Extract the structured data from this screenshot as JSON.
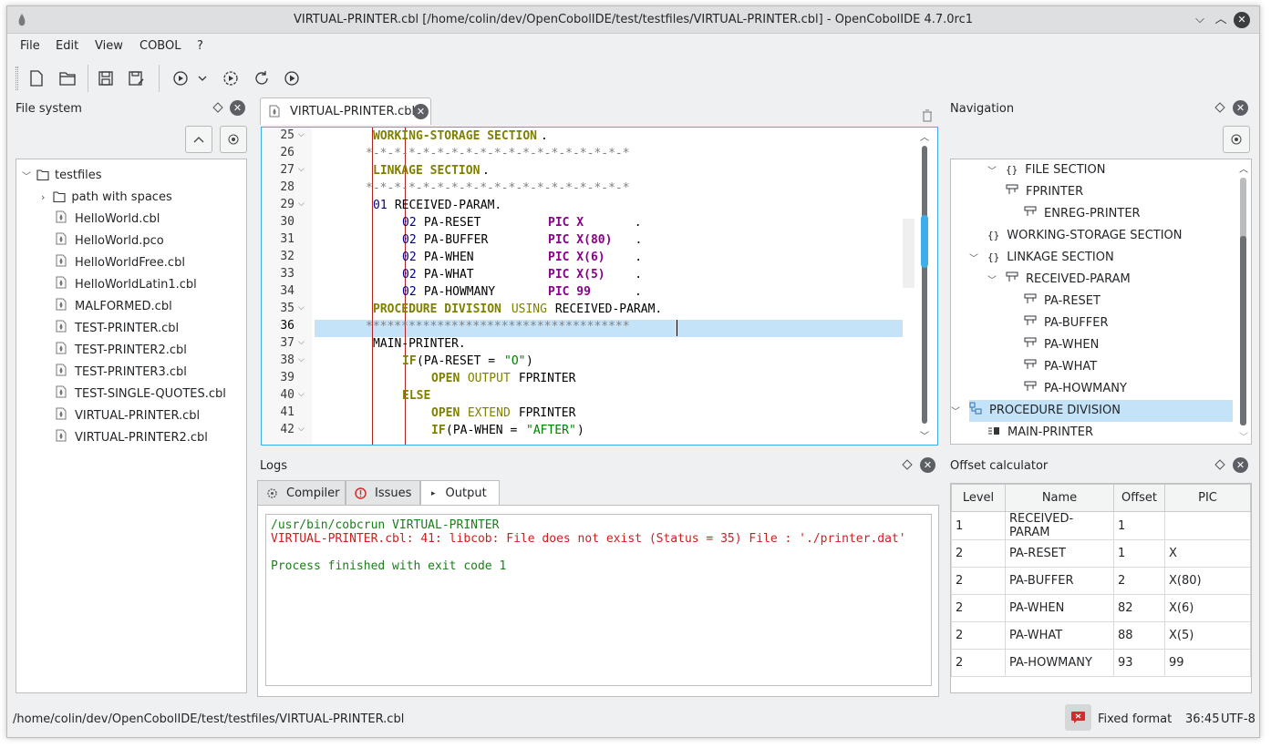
{
  "window": {
    "title": "VIRTUAL-PRINTER.cbl [/home/colin/dev/OpenCobolIDE/test/testfiles/VIRTUAL-PRINTER.cbl] - OpenCobolIDE 4.7.0rc1"
  },
  "menu": [
    "File",
    "Edit",
    "View",
    "COBOL",
    "?"
  ],
  "toolbar": {
    "icons": [
      "new-file-icon",
      "open-file-icon",
      "save-icon",
      "save-as-icon",
      "compile-icon",
      "dropdown-icon",
      "compile-all-icon",
      "clean-icon",
      "run-icon"
    ]
  },
  "file_system": {
    "title": "File system",
    "root": "testfiles",
    "folder": "path with spaces",
    "files": [
      "HelloWorld.cbl",
      "HelloWorld.pco",
      "HelloWorldFree.cbl",
      "HelloWorldLatin1.cbl",
      "MALFORMED.cbl",
      "TEST-PRINTER.cbl",
      "TEST-PRINTER2.cbl",
      "TEST-PRINTER3.cbl",
      "TEST-SINGLE-QUOTES.cbl",
      "VIRTUAL-PRINTER.cbl",
      "VIRTUAL-PRINTER2.cbl"
    ]
  },
  "editor": {
    "tab_label": "VIRTUAL-PRINTER.cbl",
    "line_numbers": [
      "25",
      "26",
      "27",
      "28",
      "29",
      "30",
      "31",
      "32",
      "33",
      "34",
      "35",
      "36",
      "37",
      "38",
      "39",
      "40",
      "41",
      "42"
    ],
    "lines": {
      "l25": {
        "a": "WORKING-STORAGE SECTION",
        "b": "."
      },
      "l26": {
        "a": "*-*-*-*-*-*-*-*-*-*-*-*-*-*-*-*-*-*-*"
      },
      "l27": {
        "a": "LINKAGE SECTION",
        "b": "."
      },
      "l28": {
        "a": "*-*-*-*-*-*-*-*-*-*-*-*-*-*-*-*-*-*-*"
      },
      "l29": {
        "a": "01",
        "b": " RECEIVED-PARAM."
      },
      "l30": {
        "a": "02",
        "b": " PA-RESET         ",
        "c": "PIC X",
        "d": "       ."
      },
      "l31": {
        "a": "02",
        "b": " PA-BUFFER        ",
        "c": "PIC X(80)",
        "d": "   ."
      },
      "l32": {
        "a": "02",
        "b": " PA-WHEN          ",
        "c": "PIC X(6)",
        "d": "    ."
      },
      "l33": {
        "a": "02",
        "b": " PA-WHAT          ",
        "c": "PIC X(5)",
        "d": "    ."
      },
      "l34": {
        "a": "02",
        "b": " PA-HOWMANY       ",
        "c": "PIC 99",
        "d": "      ."
      },
      "l35": {
        "a": "PROCEDURE DIVISION",
        "b": " USING",
        "c": " RECEIVED-PARAM."
      },
      "l36": {
        "a": "*************************************"
      },
      "l37": {
        "a": "MAIN-PRINTER."
      },
      "l38": {
        "a": "IF",
        "b": "(PA-RESET = ",
        "c": "\"O\"",
        "d": ")"
      },
      "l39": {
        "a": "OPEN",
        "b": " OUTPUT",
        "c": " FPRINTER"
      },
      "l40": {
        "a": "ELSE"
      },
      "l41": {
        "a": "OPEN",
        "b": " EXTEND",
        "c": " FPRINTER"
      },
      "l42": {
        "a": "IF",
        "b": "(PA-WHEN = ",
        "c": "\"AFTER\"",
        "d": ")"
      }
    }
  },
  "navigation": {
    "title": "Navigation",
    "items": [
      "FILE SECTION",
      "FPRINTER",
      "ENREG-PRINTER",
      "WORKING-STORAGE SECTION",
      "LINKAGE SECTION",
      "RECEIVED-PARAM",
      "PA-RESET",
      "PA-BUFFER",
      "PA-WHEN",
      "PA-WHAT",
      "PA-HOWMANY",
      "PROCEDURE DIVISION",
      "MAIN-PRINTER"
    ]
  },
  "logs": {
    "title": "Logs",
    "tabs": [
      "Compiler",
      "Issues",
      "Output"
    ],
    "lines": [
      "/usr/bin/cobcrun VIRTUAL-PRINTER",
      "VIRTUAL-PRINTER.cbl: 41: libcob: File does not exist (Status = 35) File : './printer.dat'",
      "Process finished with exit code 1"
    ]
  },
  "offset_calculator": {
    "title": "Offset calculator",
    "headers": [
      "Level",
      "Name",
      "Offset",
      "PIC"
    ],
    "rows": [
      [
        "1",
        "RECEIVED-PARAM",
        "1",
        ""
      ],
      [
        "2",
        "PA-RESET",
        "1",
        "X"
      ],
      [
        "2",
        "PA-BUFFER",
        "2",
        "X(80)"
      ],
      [
        "2",
        "PA-WHEN",
        "82",
        "X(6)"
      ],
      [
        "2",
        "PA-WHAT",
        "88",
        "X(5)"
      ],
      [
        "2",
        "PA-HOWMANY",
        "93",
        "99"
      ]
    ]
  },
  "status": {
    "path": "/home/colin/dev/OpenCobolIDE/test/testfiles/VIRTUAL-PRINTER.cbl",
    "format": "Fixed format",
    "cursor": "36:45",
    "encoding": "UTF-8"
  },
  "colors": {
    "selection": "#c5e3f8",
    "error_text": "#cc1f1f",
    "success_text": "#1a7f1a",
    "focus_border": "#3daee9"
  }
}
